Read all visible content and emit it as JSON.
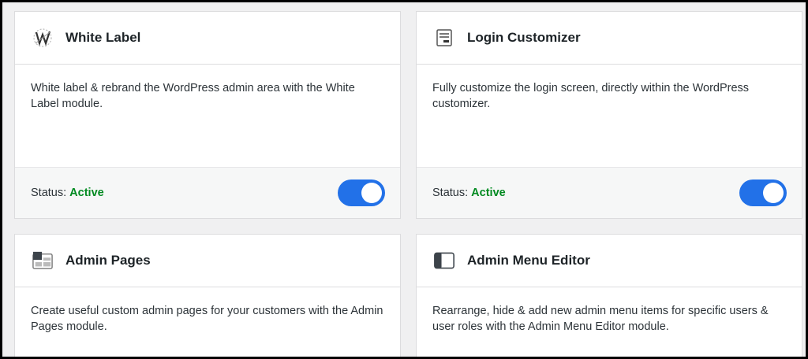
{
  "modules": [
    {
      "title": "White Label",
      "icon": "white-label-icon",
      "description": "White label & rebrand the WordPress admin area with the White Label module.",
      "status_label": "Status:",
      "status_value": "Active",
      "enabled": true
    },
    {
      "title": "Login Customizer",
      "icon": "login-screen-icon",
      "description": "Fully customize the login screen, directly within the WordPress customizer.",
      "status_label": "Status:",
      "status_value": "Active",
      "enabled": true
    },
    {
      "title": "Admin Pages",
      "icon": "admin-pages-icon",
      "description": "Create useful custom admin pages for your customers with the Admin Pages module."
    },
    {
      "title": "Admin Menu Editor",
      "icon": "sidebar-layout-icon",
      "description": "Rearrange, hide & add new admin menu items for specific users & user roles with the Admin Menu Editor module."
    }
  ],
  "colors": {
    "accent": "#2271e8",
    "status_active": "#008a20",
    "background": "#f0f0f1"
  }
}
